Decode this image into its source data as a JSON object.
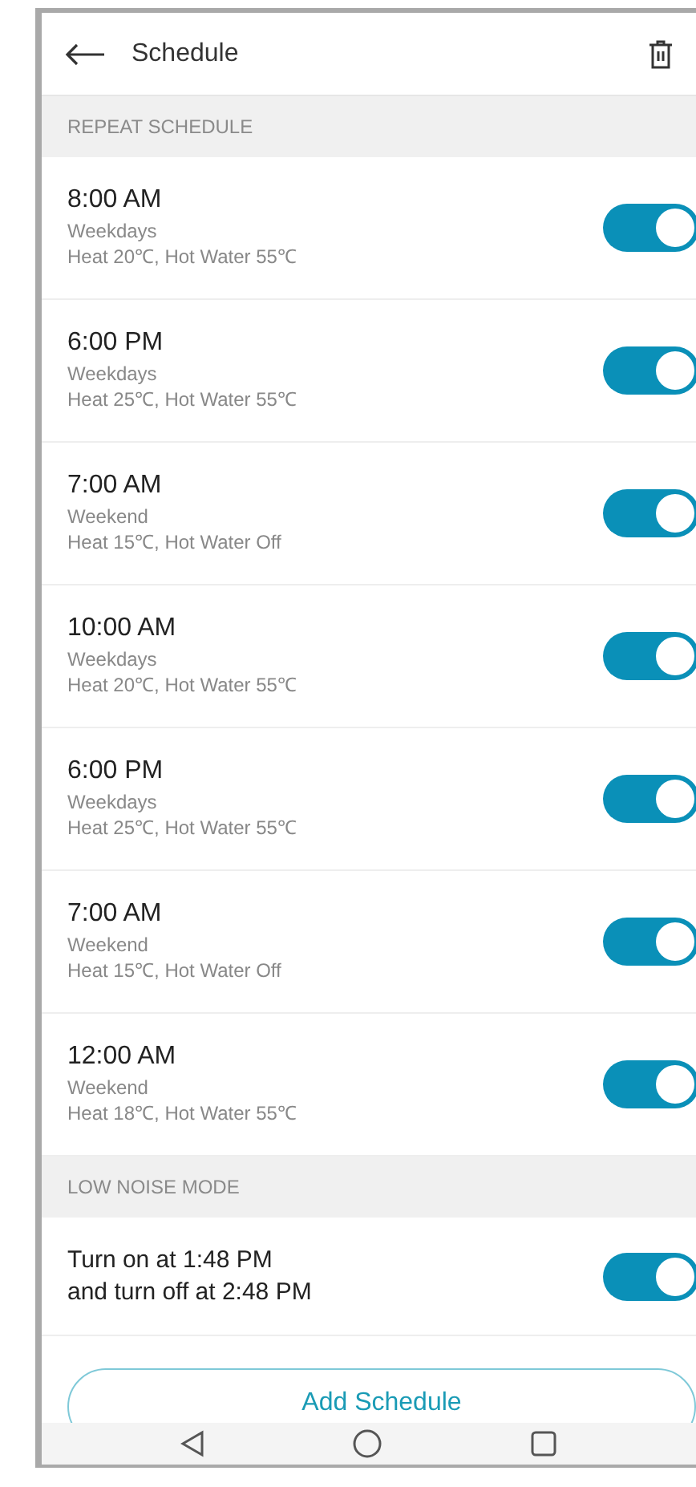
{
  "header": {
    "title": "Schedule"
  },
  "repeat_section": {
    "label": "REPEAT SCHEDULE"
  },
  "schedules": [
    {
      "time": "8:00 AM",
      "days": "Weekdays",
      "detail": "Heat 20℃, Hot Water 55℃",
      "on": true
    },
    {
      "time": "6:00 PM",
      "days": "Weekdays",
      "detail": "Heat 25℃, Hot Water 55℃",
      "on": true
    },
    {
      "time": "7:00 AM",
      "days": "Weekend",
      "detail": "Heat 15℃, Hot Water Off",
      "on": true
    },
    {
      "time": "10:00 AM",
      "days": "Weekdays",
      "detail": "Heat 20℃, Hot Water 55℃",
      "on": true
    },
    {
      "time": "6:00 PM",
      "days": "Weekdays",
      "detail": "Heat 25℃, Hot Water 55℃",
      "on": true
    },
    {
      "time": "7:00 AM",
      "days": "Weekend",
      "detail": "Heat 15℃, Hot Water Off",
      "on": true
    },
    {
      "time": "12:00 AM",
      "days": "Weekend",
      "detail": "Heat 18℃, Hot Water 55℃",
      "on": true
    }
  ],
  "low_noise_section": {
    "label": "LOW NOISE MODE"
  },
  "low_noise": {
    "lines": [
      "Turn on at 1:48 PM",
      "and turn off at 2:48 PM"
    ],
    "on": true
  },
  "add_button": {
    "label": "Add Schedule"
  }
}
